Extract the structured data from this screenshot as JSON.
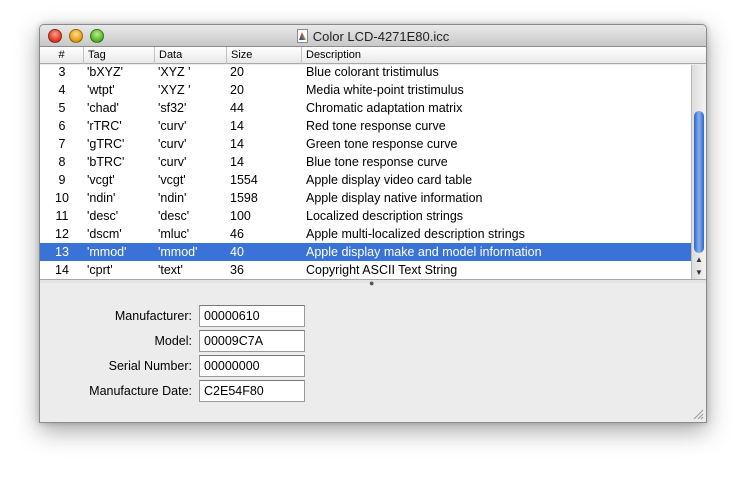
{
  "window": {
    "title": "Color LCD-4271E80.icc"
  },
  "columns": [
    "#",
    "Tag",
    "Data",
    "Size",
    "Description"
  ],
  "rows": [
    {
      "num": "3",
      "tag": "'bXYZ'",
      "data": "'XYZ '",
      "size": "20",
      "desc": "Blue colorant tristimulus"
    },
    {
      "num": "4",
      "tag": "'wtpt'",
      "data": "'XYZ '",
      "size": "20",
      "desc": "Media white-point tristimulus"
    },
    {
      "num": "5",
      "tag": "'chad'",
      "data": "'sf32'",
      "size": "44",
      "desc": "Chromatic adaptation matrix"
    },
    {
      "num": "6",
      "tag": "'rTRC'",
      "data": "'curv'",
      "size": "14",
      "desc": "Red tone response curve"
    },
    {
      "num": "7",
      "tag": "'gTRC'",
      "data": "'curv'",
      "size": "14",
      "desc": "Green tone response curve"
    },
    {
      "num": "8",
      "tag": "'bTRC'",
      "data": "'curv'",
      "size": "14",
      "desc": "Blue tone response curve"
    },
    {
      "num": "9",
      "tag": "'vcgt'",
      "data": "'vcgt'",
      "size": "1554",
      "desc": "Apple display video card table"
    },
    {
      "num": "10",
      "tag": "'ndin'",
      "data": "'ndin'",
      "size": "1598",
      "desc": "Apple display native information"
    },
    {
      "num": "11",
      "tag": "'desc'",
      "data": "'desc'",
      "size": "100",
      "desc": "Localized description strings"
    },
    {
      "num": "12",
      "tag": "'dscm'",
      "data": "'mluc'",
      "size": "46",
      "desc": "Apple multi-localized description strings"
    },
    {
      "num": "13",
      "tag": "'mmod'",
      "data": "'mmod'",
      "size": "40",
      "desc": "Apple display make and model information",
      "selected": true
    },
    {
      "num": "14",
      "tag": "'cprt'",
      "data": "'text'",
      "size": "36",
      "desc": "Copyright ASCII Text String"
    }
  ],
  "details": {
    "manufacturer_label": "Manufacturer:",
    "manufacturer_value": "00000610",
    "model_label": "Model:",
    "model_value": "00009C7A",
    "serial_label": "Serial Number:",
    "serial_value": "00000000",
    "date_label": "Manufacture Date:",
    "date_value": "C2E54F80"
  },
  "colors": {
    "selection": "#3a73d8",
    "scroll_thumb": "#3b6fd4"
  }
}
